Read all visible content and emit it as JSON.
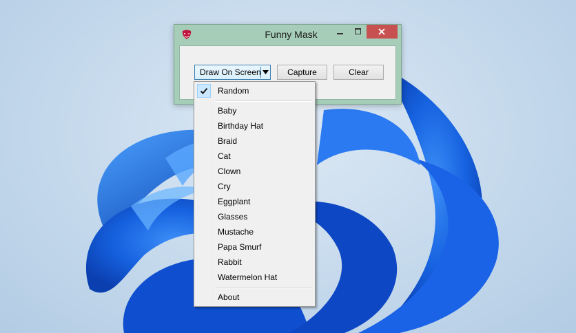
{
  "window": {
    "title": "Funny Mask",
    "icon": "mask-icon"
  },
  "toolbar": {
    "draw_label": "Draw On Screen",
    "capture_label": "Capture",
    "clear_label": "Clear"
  },
  "menu": {
    "checked_item": "Random",
    "items": [
      "Random",
      "Baby",
      "Birthday Hat",
      "Braid",
      "Cat",
      "Clown",
      "Cry",
      "Eggplant",
      "Glasses",
      "Mustache",
      "Papa Smurf",
      "Rabbit",
      "Watermelon Hat",
      "About"
    ]
  },
  "colors": {
    "window_frame": "#a6cdb8",
    "close_button": "#c75050",
    "wallpaper_bloom": "#1a5fe0"
  }
}
